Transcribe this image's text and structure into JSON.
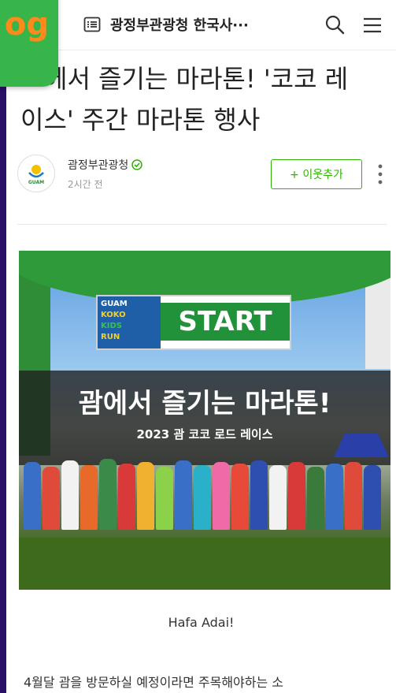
{
  "topbar": {
    "title": "광정부관광청 한국사···",
    "list_icon": "list-icon",
    "search_icon": "search-icon",
    "menu_icon": "hamburger-menu-icon"
  },
  "logo_badge": {
    "text": "og",
    "color": "#38b54a",
    "text_color": "#ff8a1c"
  },
  "post": {
    "headline_line1": "에서 즐기는 마라톤! '코코 레",
    "headline_line2": "이스' 주간 마라톤 행사",
    "author_name": "괌정부관광청",
    "time": "2시간 전",
    "follow_label": "+ 이웃추가"
  },
  "photo": {
    "banner_small_lines": [
      "GUAM",
      "KOKO",
      "KIDS",
      "RUN"
    ],
    "banner_text": "START",
    "title": "괌에서 즐기는 마라톤!",
    "subtitle": "2023 괌 코코 로드 레이스"
  },
  "content": {
    "greeting": "Hafa Adai!",
    "paragraph_start": "4월달 괌을 방문하실 예정이라면 주목해야하는 소"
  },
  "colors": {
    "accent_green": "#2db400",
    "background_frame": "#2a0f66"
  }
}
